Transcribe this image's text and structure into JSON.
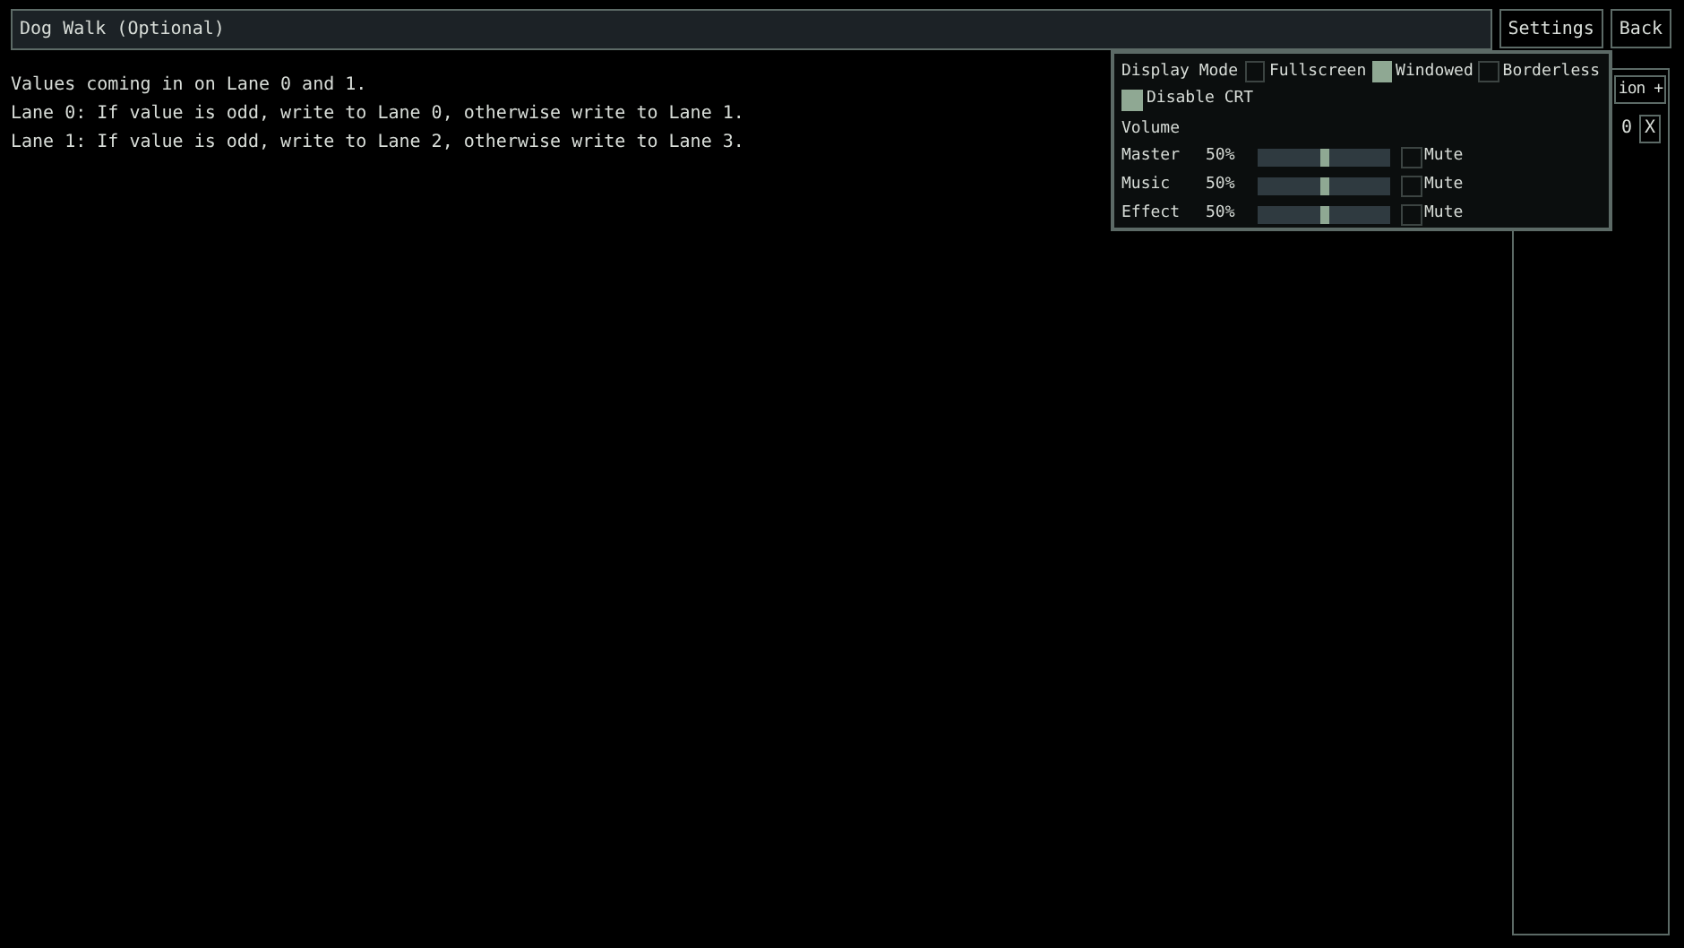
{
  "title_field": {
    "value": "Dog Walk (Optional)"
  },
  "top_buttons": [
    "Settings",
    "Back"
  ],
  "description": [
    "Values coming in on Lane 0 and 1.",
    "Lane 0: If value is odd, write to Lane 0, otherwise write to Lane 1.",
    "Lane 1: If value is odd, write to Lane 2, otherwise write to Lane 3."
  ],
  "side_panel": {
    "add_button": "ion +",
    "value_fragment": "0",
    "remove_button": "X"
  },
  "settings": {
    "display_mode_label": "Display Mode",
    "display_modes": [
      {
        "label": "Fullscreen",
        "selected": false
      },
      {
        "label": "Windowed",
        "selected": true
      },
      {
        "label": "Borderless",
        "selected": false
      }
    ],
    "crt": {
      "label": "Disable CRT",
      "checked": true
    },
    "volume_label": "Volume",
    "volumes": [
      {
        "name": "Master",
        "reading": "50%",
        "level": 0.5,
        "mute_label": "Mute",
        "muted": false
      },
      {
        "name": "Music",
        "reading": "50%",
        "level": 0.5,
        "mute_label": "Mute",
        "muted": false
      },
      {
        "name": "Effect",
        "reading": "50%",
        "level": 0.5,
        "mute_label": "Mute",
        "muted": false
      }
    ]
  }
}
